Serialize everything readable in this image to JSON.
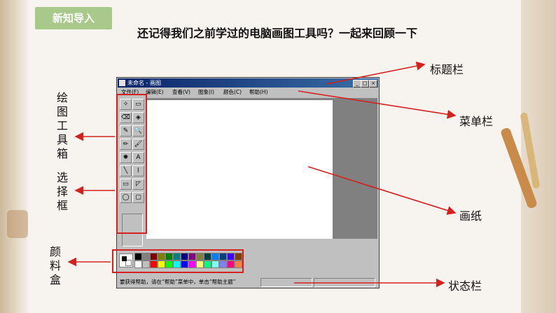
{
  "section_tag": "新知导入",
  "heading": "还记得我们之前学过的电脑画图工具吗？一起来回顾一下",
  "paint_window": {
    "title": "未命名 - 画图",
    "title_buttons": [
      "_",
      "□",
      "×"
    ],
    "menu": [
      "文件(F)",
      "编辑(E)",
      "查看(V)",
      "图象(I)",
      "颜色(C)",
      "帮助(H)"
    ],
    "tools": [
      "✧",
      "▭",
      "⌫",
      "◈",
      "✎",
      "🔍",
      "✏",
      "🖌",
      "✺",
      "A",
      "╲",
      "⌇",
      "▭",
      "◸",
      "◯",
      "▢"
    ],
    "palette_top": [
      "#000000",
      "#808080",
      "#800000",
      "#808000",
      "#008000",
      "#008080",
      "#000080",
      "#800080",
      "#808040",
      "#004040",
      "#0080ff",
      "#004080",
      "#4000ff",
      "#804000"
    ],
    "palette_bottom": [
      "#ffffff",
      "#c0c0c0",
      "#ff0000",
      "#ffff00",
      "#00ff00",
      "#00ffff",
      "#0000ff",
      "#ff00ff",
      "#ffff80",
      "#00ff80",
      "#80ffff",
      "#8080ff",
      "#ff0080",
      "#ff8040"
    ],
    "status_text": "要获得帮助，请在“帮助”菜单中，单击“帮助主题”"
  },
  "labels": {
    "title_bar": "标题栏",
    "menu_bar": "菜单栏",
    "toolbox": "绘图工具箱",
    "options": "选择框",
    "canvas": "画纸",
    "palette": "颜料盒",
    "status_bar": "状态栏"
  },
  "colors": {
    "annotation": "#d62020",
    "tag_bg": "#a9c98b",
    "title_bar": "#0a246a"
  }
}
